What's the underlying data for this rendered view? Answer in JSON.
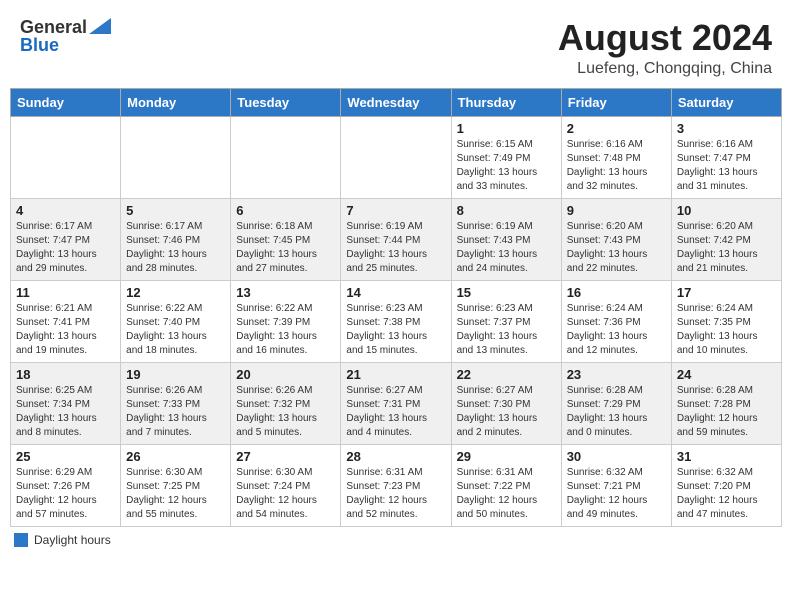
{
  "header": {
    "logo_general": "General",
    "logo_blue": "Blue",
    "month_title": "August 2024",
    "location": "Luefeng, Chongqing, China"
  },
  "days_of_week": [
    "Sunday",
    "Monday",
    "Tuesday",
    "Wednesday",
    "Thursday",
    "Friday",
    "Saturday"
  ],
  "weeks": [
    [
      {
        "day": "",
        "info": ""
      },
      {
        "day": "",
        "info": ""
      },
      {
        "day": "",
        "info": ""
      },
      {
        "day": "",
        "info": ""
      },
      {
        "day": "1",
        "info": "Sunrise: 6:15 AM\nSunset: 7:49 PM\nDaylight: 13 hours and 33 minutes."
      },
      {
        "day": "2",
        "info": "Sunrise: 6:16 AM\nSunset: 7:48 PM\nDaylight: 13 hours and 32 minutes."
      },
      {
        "day": "3",
        "info": "Sunrise: 6:16 AM\nSunset: 7:47 PM\nDaylight: 13 hours and 31 minutes."
      }
    ],
    [
      {
        "day": "4",
        "info": "Sunrise: 6:17 AM\nSunset: 7:47 PM\nDaylight: 13 hours and 29 minutes."
      },
      {
        "day": "5",
        "info": "Sunrise: 6:17 AM\nSunset: 7:46 PM\nDaylight: 13 hours and 28 minutes."
      },
      {
        "day": "6",
        "info": "Sunrise: 6:18 AM\nSunset: 7:45 PM\nDaylight: 13 hours and 27 minutes."
      },
      {
        "day": "7",
        "info": "Sunrise: 6:19 AM\nSunset: 7:44 PM\nDaylight: 13 hours and 25 minutes."
      },
      {
        "day": "8",
        "info": "Sunrise: 6:19 AM\nSunset: 7:43 PM\nDaylight: 13 hours and 24 minutes."
      },
      {
        "day": "9",
        "info": "Sunrise: 6:20 AM\nSunset: 7:43 PM\nDaylight: 13 hours and 22 minutes."
      },
      {
        "day": "10",
        "info": "Sunrise: 6:20 AM\nSunset: 7:42 PM\nDaylight: 13 hours and 21 minutes."
      }
    ],
    [
      {
        "day": "11",
        "info": "Sunrise: 6:21 AM\nSunset: 7:41 PM\nDaylight: 13 hours and 19 minutes."
      },
      {
        "day": "12",
        "info": "Sunrise: 6:22 AM\nSunset: 7:40 PM\nDaylight: 13 hours and 18 minutes."
      },
      {
        "day": "13",
        "info": "Sunrise: 6:22 AM\nSunset: 7:39 PM\nDaylight: 13 hours and 16 minutes."
      },
      {
        "day": "14",
        "info": "Sunrise: 6:23 AM\nSunset: 7:38 PM\nDaylight: 13 hours and 15 minutes."
      },
      {
        "day": "15",
        "info": "Sunrise: 6:23 AM\nSunset: 7:37 PM\nDaylight: 13 hours and 13 minutes."
      },
      {
        "day": "16",
        "info": "Sunrise: 6:24 AM\nSunset: 7:36 PM\nDaylight: 13 hours and 12 minutes."
      },
      {
        "day": "17",
        "info": "Sunrise: 6:24 AM\nSunset: 7:35 PM\nDaylight: 13 hours and 10 minutes."
      }
    ],
    [
      {
        "day": "18",
        "info": "Sunrise: 6:25 AM\nSunset: 7:34 PM\nDaylight: 13 hours and 8 minutes."
      },
      {
        "day": "19",
        "info": "Sunrise: 6:26 AM\nSunset: 7:33 PM\nDaylight: 13 hours and 7 minutes."
      },
      {
        "day": "20",
        "info": "Sunrise: 6:26 AM\nSunset: 7:32 PM\nDaylight: 13 hours and 5 minutes."
      },
      {
        "day": "21",
        "info": "Sunrise: 6:27 AM\nSunset: 7:31 PM\nDaylight: 13 hours and 4 minutes."
      },
      {
        "day": "22",
        "info": "Sunrise: 6:27 AM\nSunset: 7:30 PM\nDaylight: 13 hours and 2 minutes."
      },
      {
        "day": "23",
        "info": "Sunrise: 6:28 AM\nSunset: 7:29 PM\nDaylight: 13 hours and 0 minutes."
      },
      {
        "day": "24",
        "info": "Sunrise: 6:28 AM\nSunset: 7:28 PM\nDaylight: 12 hours and 59 minutes."
      }
    ],
    [
      {
        "day": "25",
        "info": "Sunrise: 6:29 AM\nSunset: 7:26 PM\nDaylight: 12 hours and 57 minutes."
      },
      {
        "day": "26",
        "info": "Sunrise: 6:30 AM\nSunset: 7:25 PM\nDaylight: 12 hours and 55 minutes."
      },
      {
        "day": "27",
        "info": "Sunrise: 6:30 AM\nSunset: 7:24 PM\nDaylight: 12 hours and 54 minutes."
      },
      {
        "day": "28",
        "info": "Sunrise: 6:31 AM\nSunset: 7:23 PM\nDaylight: 12 hours and 52 minutes."
      },
      {
        "day": "29",
        "info": "Sunrise: 6:31 AM\nSunset: 7:22 PM\nDaylight: 12 hours and 50 minutes."
      },
      {
        "day": "30",
        "info": "Sunrise: 6:32 AM\nSunset: 7:21 PM\nDaylight: 12 hours and 49 minutes."
      },
      {
        "day": "31",
        "info": "Sunrise: 6:32 AM\nSunset: 7:20 PM\nDaylight: 12 hours and 47 minutes."
      }
    ]
  ],
  "legend": {
    "label": "Daylight hours"
  }
}
